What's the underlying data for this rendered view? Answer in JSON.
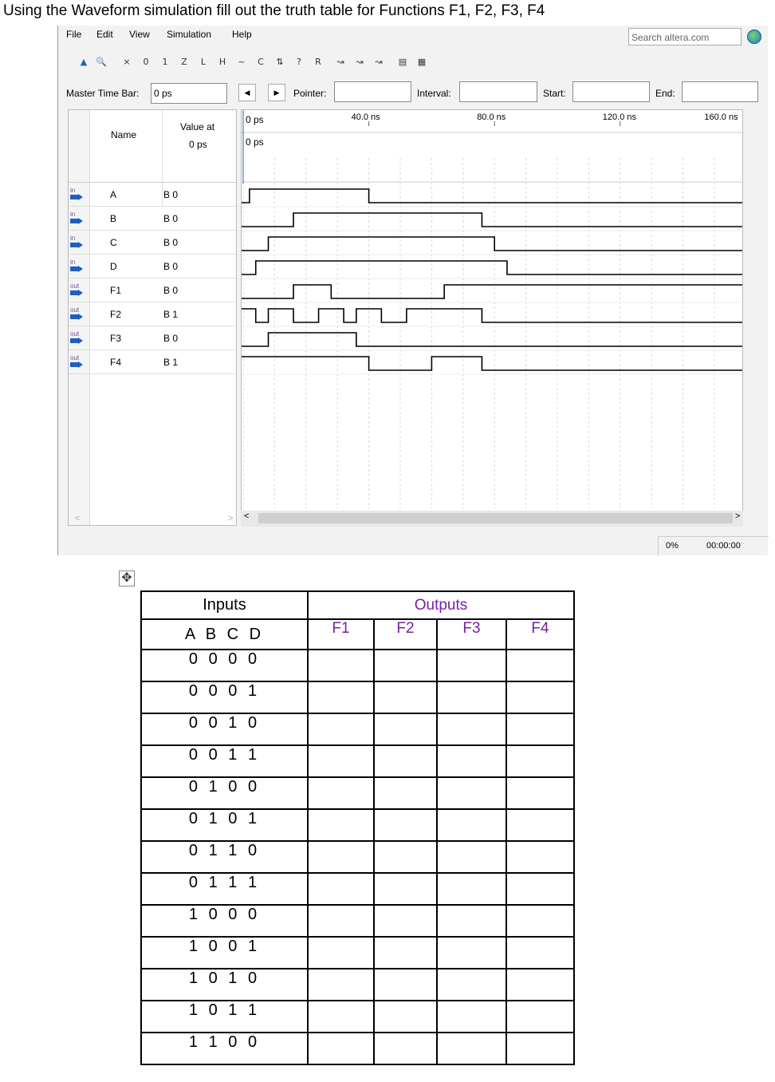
{
  "question": "Using the Waveform simulation fill out the truth table for Functions F1, F2, F3, F4",
  "menu": [
    "File",
    "Edit",
    "View",
    "Simulation",
    "Help"
  ],
  "search_placeholder": "Search altera.com",
  "toolbar_labels": {
    "master_time_bar": "Master Time Bar:",
    "master_time_value": "0 ps",
    "pointer": "Pointer:",
    "interval": "Interval:",
    "start": "Start:",
    "end": "End:"
  },
  "grid_header": {
    "name": "Name",
    "value_at": "Value at",
    "value_time": "0 ps"
  },
  "signals": [
    {
      "dir": "in",
      "name": "A",
      "value": "B 0",
      "transitions": [
        2,
        40
      ]
    },
    {
      "dir": "in",
      "name": "B",
      "value": "B 0",
      "transitions": [
        16,
        76
      ]
    },
    {
      "dir": "in",
      "name": "C",
      "value": "B 0",
      "transitions": [
        8,
        80
      ]
    },
    {
      "dir": "in",
      "name": "D",
      "value": "B 0",
      "transitions": [
        4,
        84
      ]
    },
    {
      "dir": "out",
      "name": "F1",
      "value": "B 0",
      "transitions": [
        16,
        28,
        64
      ]
    },
    {
      "dir": "out",
      "name": "F2",
      "value": "B 1",
      "transitions": [
        4,
        8,
        16,
        24,
        32,
        36,
        44,
        52,
        76
      ]
    },
    {
      "dir": "out",
      "name": "F3",
      "value": "B 0",
      "transitions": [
        8,
        36
      ]
    },
    {
      "dir": "out",
      "name": "F4",
      "value": "B 1",
      "transitions": [
        40,
        60,
        76
      ]
    }
  ],
  "timeline": {
    "cursor_label": "0 ps",
    "cursor_sub": "0 ps",
    "ticks": [
      "40.0 ns",
      "80.0 ns",
      "120.0 ns",
      "160.0 ns"
    ]
  },
  "status": {
    "progress": "0%",
    "elapsed": "00:00:00"
  },
  "truth_table": {
    "inputs_header": "Inputs",
    "outputs_header": "Outputs",
    "input_cols": "A B C D",
    "output_cols": [
      "F1",
      "F2",
      "F3",
      "F4"
    ],
    "rows": [
      "0 0 0 0",
      "0 0 0 1",
      "0 0 1 0",
      "0 0 1 1",
      "0 1 0 0",
      "0 1 0 1",
      "0 1 1 0",
      "0 1 1 1",
      "1 0 0 0",
      "1 0 0 1",
      "1 0 1 0",
      "1 0 1 1",
      "1 1 0 0"
    ]
  },
  "colors": {
    "pin_blue": "#1f5fbf",
    "outputs_purple": "#7a1fa0"
  }
}
